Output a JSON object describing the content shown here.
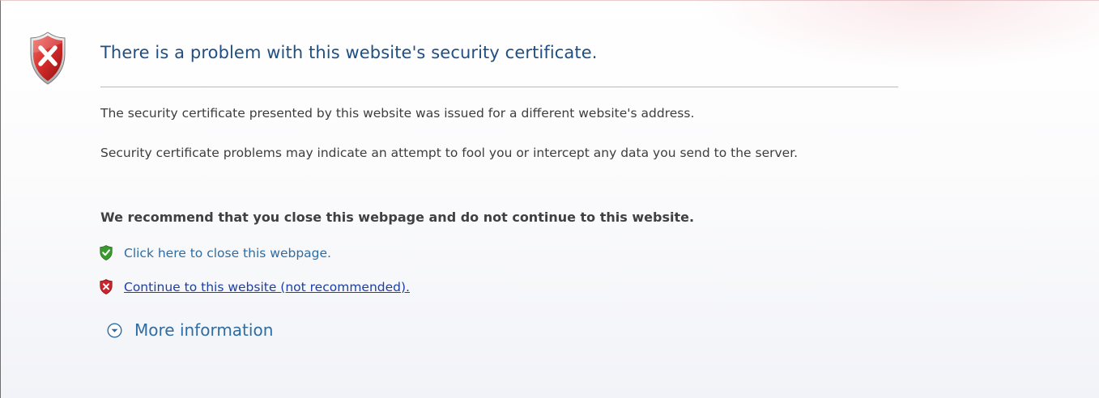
{
  "page": {
    "title": "There is a problem with this website's security certificate.",
    "paragraph_1": "The security certificate presented by this website was issued for a different website's address.",
    "paragraph_2": "Security certificate problems may indicate an attempt to fool you or intercept any data you send to the server.",
    "recommendation": "We recommend that you close this webpage and do not continue to this website."
  },
  "actions": {
    "close_label": "Click here to close this webpage.",
    "continue_label": "Continue to this website (not recommended).",
    "more_info_label": "More information"
  },
  "icons": {
    "header": "shield-error-icon",
    "close": "shield-check-icon",
    "continue": "shield-error-icon",
    "more_info": "chevron-down-circle-icon"
  },
  "colors": {
    "title": "#1f4f84",
    "body_text": "#3d3d3d",
    "link": "#2f6ca1",
    "visited_link": "#1b3fa6",
    "error_red": "#c8252c",
    "safe_green": "#3b9a2f"
  }
}
